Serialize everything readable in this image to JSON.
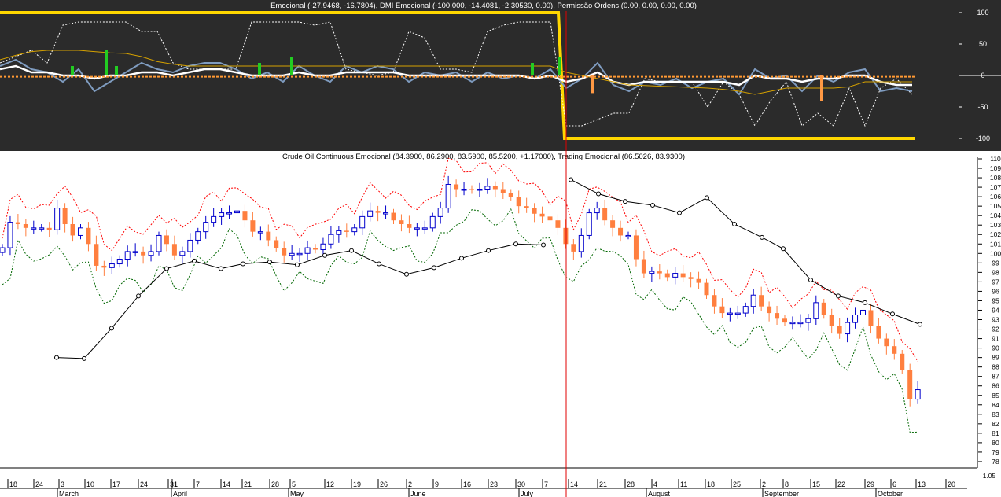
{
  "chart_data": [
    {
      "type": "line",
      "title": "Emocional (-27.9468, -16.7804), DMI Emocional (-100.000, -14.4081, -2.30530, 0.00), Permissão Ordens (0.00, 0.00, 0.00, 0.00)",
      "ylim": [
        -100,
        100
      ],
      "y_ticks": [
        "100",
        "50",
        "0",
        "-50",
        "-100"
      ],
      "x_step_days": 3,
      "series": [
        {
          "name": "Permissão Ordens",
          "color": "#ffd700",
          "values_note": "step",
          "segments": [
            [
              0,
              100
            ],
            [
              710,
              100
            ],
            [
              718,
              -100
            ],
            [
              1163,
              -100
            ]
          ]
        },
        {
          "name": "DMI Emocional dotted",
          "color": "#ffffff",
          "values": [
            20,
            30,
            40,
            20,
            80,
            85,
            85,
            85,
            85,
            70,
            70,
            20,
            10,
            10,
            10,
            10,
            85,
            85,
            85,
            85,
            80,
            85,
            10,
            5,
            0,
            5,
            70,
            60,
            10,
            10,
            5,
            70,
            80,
            85,
            85,
            85,
            -80,
            -80,
            -70,
            -60,
            -60,
            -5,
            -10,
            -10,
            -10,
            -50,
            -10,
            -30,
            -80,
            -40,
            -10,
            -80,
            -60,
            -80,
            -20,
            -80,
            -20,
            -5,
            -30
          ]
        },
        {
          "name": "Emocional fast",
          "color": "#7f9cc0",
          "values": [
            15,
            25,
            10,
            5,
            -10,
            10,
            -25,
            -10,
            5,
            20,
            10,
            5,
            15,
            20,
            20,
            10,
            -5,
            5,
            -10,
            15,
            0,
            -10,
            15,
            5,
            15,
            10,
            -10,
            5,
            0,
            5,
            -10,
            5,
            -5,
            0,
            -5,
            10,
            -20,
            -5,
            20,
            -15,
            -25,
            -10,
            -15,
            -5,
            -20,
            -10,
            -5,
            -30,
            10,
            -5,
            0,
            -25,
            0,
            -10,
            5,
            10,
            -25,
            -20,
            -25
          ]
        },
        {
          "name": "Emocional slow",
          "color": "#ffffff",
          "values": [
            10,
            15,
            5,
            5,
            0,
            0,
            -5,
            0,
            0,
            5,
            5,
            0,
            5,
            10,
            10,
            5,
            0,
            0,
            0,
            5,
            0,
            0,
            5,
            5,
            5,
            5,
            0,
            0,
            0,
            0,
            0,
            0,
            0,
            0,
            -5,
            0,
            -10,
            -5,
            5,
            -10,
            -15,
            -10,
            -10,
            -10,
            -10,
            -10,
            -10,
            -15,
            0,
            -5,
            -5,
            -10,
            -5,
            -5,
            0,
            0,
            -10,
            -15,
            -15
          ]
        },
        {
          "name": "Emocional average",
          "color": "#d4a000",
          "values": [
            25,
            32,
            38,
            40,
            40,
            40,
            38,
            36,
            35,
            30,
            22,
            18,
            15,
            15,
            15,
            15,
            15,
            15,
            15,
            15,
            15,
            15,
            15,
            15,
            15,
            15,
            15,
            15,
            15,
            15,
            15,
            15,
            15,
            15,
            15,
            15,
            5,
            0,
            -5,
            -10,
            -15,
            -16,
            -17,
            -18,
            -19,
            -20,
            -22,
            -25,
            -30,
            -25,
            -20,
            -20,
            -20,
            -20,
            -18,
            -10,
            -10,
            -10,
            -10
          ]
        },
        {
          "name": "Zero line",
          "color": "#ff9933",
          "constant": -2
        }
      ],
      "histogram": [
        {
          "index": 4.6,
          "value": 15,
          "color": "#22cc22"
        },
        {
          "index": 6.75,
          "value": 40,
          "color": "#22cc22"
        },
        {
          "index": 7.4,
          "value": 15,
          "color": "#22cc22"
        },
        {
          "index": 16.5,
          "value": 20,
          "color": "#22cc22"
        },
        {
          "index": 18.55,
          "value": 30,
          "color": "#22cc22"
        },
        {
          "index": 33.85,
          "value": 20,
          "color": "#22cc22"
        },
        {
          "index": 35.6,
          "value": 30,
          "color": "#22cc22"
        },
        {
          "index": 37.65,
          "value": -28,
          "color": "#ff9944"
        },
        {
          "index": 52.25,
          "value": -40,
          "color": "#ff9944"
        }
      ]
    },
    {
      "type": "candlestick",
      "title": "Crude Oil Continuous Emocional (84.3900, 86.2900, 83.5900, 85.5200, +1.17000), Trading Emocional (86.5026, 83.9300)",
      "ylim": [
        78,
        110
      ],
      "y_ticks": [
        "110",
        "109",
        "108",
        "107",
        "106",
        "105",
        "104",
        "103",
        "102",
        "101",
        "100",
        "99",
        "98",
        "97",
        "96",
        "95",
        "94",
        "93",
        "92",
        "91",
        "90",
        "89",
        "88",
        "87",
        "86",
        "85",
        "84",
        "83",
        "82",
        "81",
        "80",
        "79",
        "78"
      ],
      "bottom_pane_tick": "1.05",
      "closes": [
        100.6,
        103.3,
        103.1,
        102.7,
        102.7,
        102.7,
        102.5,
        104.8,
        103.1,
        101.9,
        102.7,
        101.0,
        98.7,
        98.5,
        98.9,
        99.4,
        100.2,
        100.2,
        99.8,
        100.2,
        101.9,
        101.0,
        99.8,
        100.2,
        101.4,
        102.3,
        103.3,
        103.9,
        104.3,
        104.3,
        104.5,
        103.5,
        102.3,
        102.3,
        101.4,
        100.6,
        99.8,
        100.0,
        100.0,
        100.6,
        100.4,
        101.0,
        102.0,
        102.4,
        102.3,
        102.7,
        103.9,
        104.5,
        104.3,
        104.3,
        103.5,
        103.1,
        102.7,
        102.7,
        102.7,
        103.9,
        104.8,
        107.3,
        106.8,
        106.8,
        106.7,
        106.8,
        107.1,
        106.8,
        106.4,
        106.0,
        105.0,
        104.8,
        104.2,
        103.9,
        103.5,
        102.7,
        101.0,
        100.2,
        101.9,
        104.3,
        104.8,
        103.5,
        102.7,
        101.9,
        101.9,
        99.4,
        97.9,
        98.1,
        97.9,
        97.5,
        97.9,
        97.5,
        97.3,
        96.9,
        95.6,
        94.4,
        93.7,
        93.7,
        93.7,
        94.4,
        95.6,
        94.4,
        93.7,
        93.1,
        92.7,
        92.7,
        92.7,
        93.1,
        94.8,
        93.5,
        92.3,
        91.5,
        92.7,
        93.5,
        94.0,
        92.3,
        91.0,
        90.2,
        89.4,
        87.7,
        84.6,
        85.6
      ],
      "trading_emocional": {
        "segment_1": [
          [
            7.2,
            89.0
          ],
          [
            10.7,
            88.9
          ],
          [
            14.2,
            92.1
          ],
          [
            17.6,
            95.5
          ],
          [
            21.2,
            98.4
          ],
          [
            24.7,
            99.2
          ],
          [
            28.1,
            98.4
          ],
          [
            30.9,
            98.9
          ],
          [
            34.3,
            99.1
          ],
          [
            37.8,
            98.8
          ],
          [
            41.3,
            99.8
          ],
          [
            44.7,
            100.3
          ],
          [
            48.2,
            98.9
          ],
          [
            51.7,
            97.8
          ],
          [
            55.2,
            98.5
          ],
          [
            58.7,
            99.5
          ],
          [
            62.1,
            100.3
          ],
          [
            65.6,
            101.0
          ],
          [
            69.1,
            100.9
          ]
        ],
        "segment_2": [
          [
            72.6,
            107.8
          ],
          [
            76.1,
            106.3
          ],
          [
            79.5,
            105.5
          ],
          [
            83.0,
            105.1
          ],
          [
            86.4,
            104.3
          ],
          [
            89.9,
            105.9
          ],
          [
            93.4,
            103.1
          ],
          [
            96.9,
            101.7
          ],
          [
            99.6,
            100.5
          ],
          [
            103.1,
            97.2
          ],
          [
            106.6,
            95.5
          ],
          [
            110.0,
            94.8
          ],
          [
            113.5,
            93.6
          ],
          [
            117.0,
            92.5
          ]
        ]
      },
      "colors": {
        "up_body": "#ffffff",
        "up_outline": "#0000cc",
        "down_body": "#ff7f3f",
        "upper_band": "#ff0000",
        "lower_band": "#006600",
        "cursor": "#e00000"
      }
    }
  ],
  "x_axis": {
    "days": [
      "18",
      "24",
      "3",
      "10",
      "17",
      "24",
      "31",
      "1",
      "7",
      "14",
      "21",
      "28",
      "5",
      "12",
      "19",
      "26",
      "2",
      "9",
      "16",
      "23",
      "30",
      "7",
      "14",
      "21",
      "28",
      "4",
      "11",
      "18",
      "25",
      "2",
      "8",
      "15",
      "22",
      "29",
      "6",
      "13",
      "20"
    ],
    "months": [
      "March",
      "April",
      "May",
      "June",
      "July",
      "August",
      "September",
      "October"
    ]
  }
}
